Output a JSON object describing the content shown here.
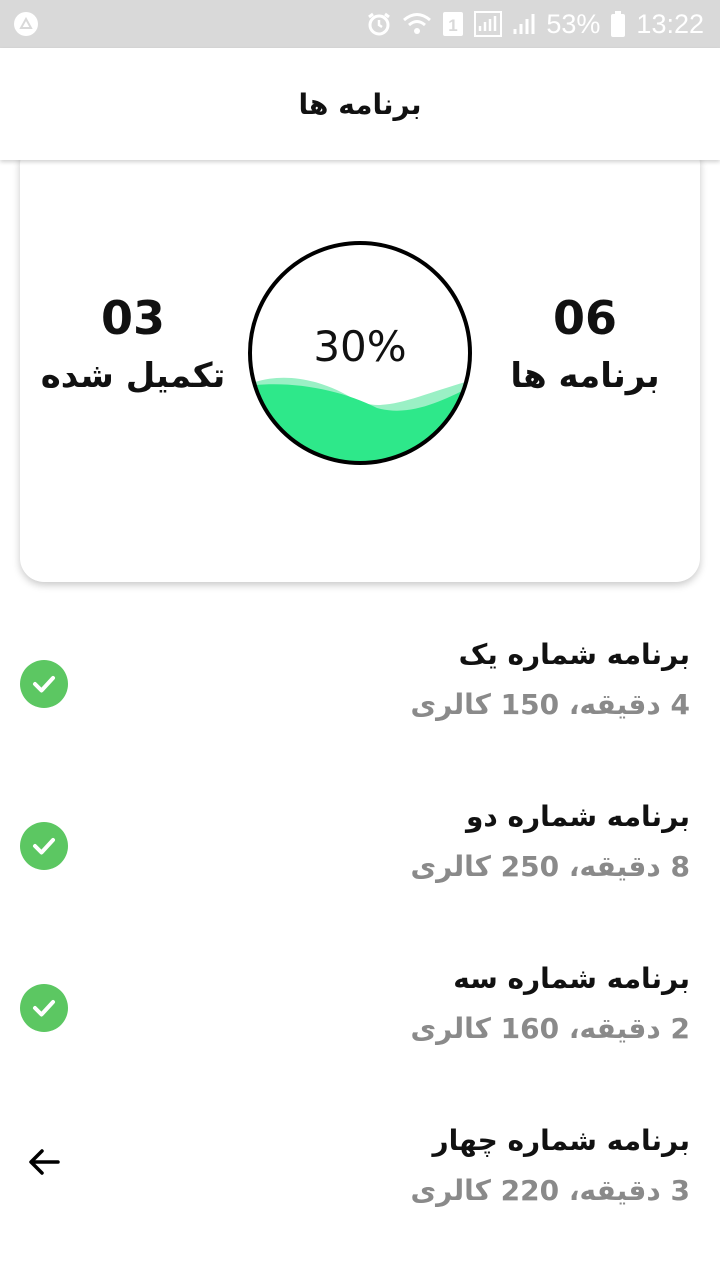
{
  "status_bar": {
    "battery": "53%",
    "time": "13:22",
    "sim_badge": "1",
    "icons": [
      "app-notification-icon",
      "alarm-icon",
      "wifi-icon",
      "sim-icon",
      "signal-icon",
      "battery-icon"
    ]
  },
  "app_bar": {
    "title": "برنامه ها"
  },
  "summary": {
    "programs_count": "06",
    "programs_label": "برنامه ها",
    "completed_count": "03",
    "completed_label": "تکمیل شده",
    "progress_text": "30%",
    "progress_value": 0.3
  },
  "colors": {
    "accent_green": "#2ee88a",
    "accent_green_light": "#9af0c5",
    "check_green": "#5cc762",
    "subtitle_gray": "#8a8a8a"
  },
  "programs": [
    {
      "title": "برنامه شماره یک",
      "subtitle": "4 دقیقه، 150 کالری",
      "status": "completed",
      "icon": "check-circle-icon"
    },
    {
      "title": "برنامه شماره دو",
      "subtitle": "8 دقیقه، 250 کالری",
      "status": "completed",
      "icon": "check-circle-icon"
    },
    {
      "title": "برنامه شماره سه",
      "subtitle": "2 دقیقه، 160 کالری",
      "status": "completed",
      "icon": "check-circle-icon"
    },
    {
      "title": "برنامه شماره چهار",
      "subtitle": "3 دقیقه، 220 کالری",
      "status": "pending",
      "icon": "arrow-left-icon"
    }
  ]
}
